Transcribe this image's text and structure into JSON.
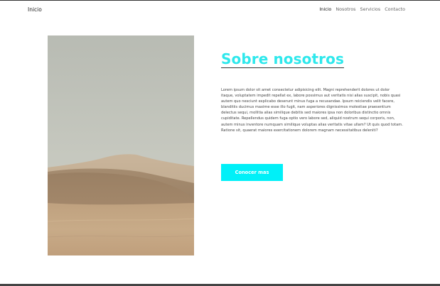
{
  "nav": {
    "brand": "Inicio",
    "links": [
      "Inicio",
      "Nosotros",
      "Servicios",
      "Contacto"
    ],
    "active_index": 0
  },
  "about": {
    "title": "Sobre nosotros",
    "paragraph": "Lorem ipsum dolor sit amet consectetur adipisicing elit. Magni reprehenderit dolores ut dolor itaque, voluptatem impedit repellat ex, labore possimus aut veritatis nisi alias suscipit, nobis quasi autem quo nesciunt explicabo deserunt minus fuga a recusandae. Ipsum reiciendis velit facere, blanditiis ducimus maxime esse illo fugit, nam asperiores dignissimos molestiae praesentium delectus sequi, mollitia alias similique debitis sed maiores ipsa non doloribus distinctio omnis cupiditate. Repellendus quidem fuga optio vero labore sed, aliquid nostrum sequi corporis, non, autem minus inventore numquam similique voluptas alias veritatis vitae ullam? Ut quis quod totam. Ratione sit, quaerat maiores exercitationem dolorem magnam necessitatibus deleniti?",
    "button_label": "Conocer mas"
  },
  "colors": {
    "accent": "#00f0f8",
    "title": "#2ee8ec"
  },
  "image": {
    "subject": "desert-dunes"
  }
}
